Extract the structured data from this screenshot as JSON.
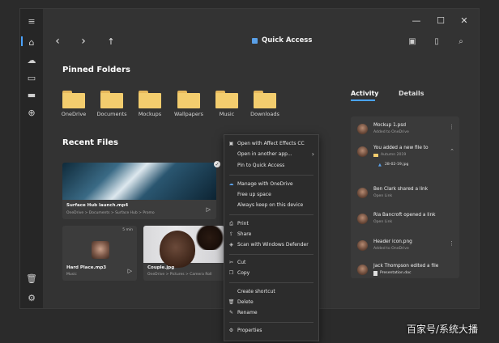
{
  "window": {
    "title": "Quick Access",
    "controls": {
      "minimize": "—",
      "maximize": "☐",
      "close": "✕"
    }
  },
  "nav": {
    "back": "‹",
    "forward": "›",
    "up": "↑"
  },
  "toolbar": {
    "more": "···"
  },
  "pinned": {
    "title": "Pinned Folders",
    "folders": [
      {
        "label": "OneDrive"
      },
      {
        "label": "Documents"
      },
      {
        "label": "Mockups"
      },
      {
        "label": "Wallpapers"
      },
      {
        "label": "Music"
      },
      {
        "label": "Downloads"
      }
    ]
  },
  "recent": {
    "title": "Recent Files",
    "files": [
      {
        "name": "Surface Hub launch.mp4",
        "path": "OneDrive > Documents > Surface Hub > Promo"
      },
      {
        "name": "Hard Place.mp3",
        "path": "Music",
        "badge": "5 min"
      },
      {
        "name": "Couple.jpg",
        "path": "OneDrive > Pictures > Camera Roll"
      }
    ]
  },
  "tabs": {
    "activity": "Activity",
    "details": "Details"
  },
  "activity": [
    {
      "title": "Mockup 1.psd",
      "sub": "Added to OneDrive"
    },
    {
      "title": "You added a new file to",
      "sub": "Autumn 2019",
      "file": "28-02-19.jpg"
    },
    {
      "title": "Ben Clark shared a link",
      "sub": "Open Link"
    },
    {
      "title": "Ria Bancroft opened a link",
      "sub": "Open Link"
    },
    {
      "title": "Header icon.png",
      "sub": "Added to OneDrive"
    },
    {
      "title": "Jack Thompson edited a file",
      "file": "Presentation.doc"
    }
  ],
  "context_menu": {
    "items": [
      {
        "label": "Open with Affect Effects CC"
      },
      {
        "label": "Open in another app..."
      },
      {
        "label": "Pin to Quick Access"
      },
      {
        "label": "Manage with OneDrive"
      },
      {
        "label": "Free up space"
      },
      {
        "label": "Always keep on this device"
      },
      {
        "label": "Print"
      },
      {
        "label": "Share"
      },
      {
        "label": "Scan with Windows Defender"
      },
      {
        "label": "Cut"
      },
      {
        "label": "Copy"
      },
      {
        "label": "Create shortcut"
      },
      {
        "label": "Delete"
      },
      {
        "label": "Rename"
      },
      {
        "label": "Properties"
      }
    ]
  },
  "watermark": "百家号/系统大播",
  "colors": {
    "accent": "#4aa3ff",
    "folder": "#f3cd6e",
    "panel": "#3a3a3a"
  }
}
